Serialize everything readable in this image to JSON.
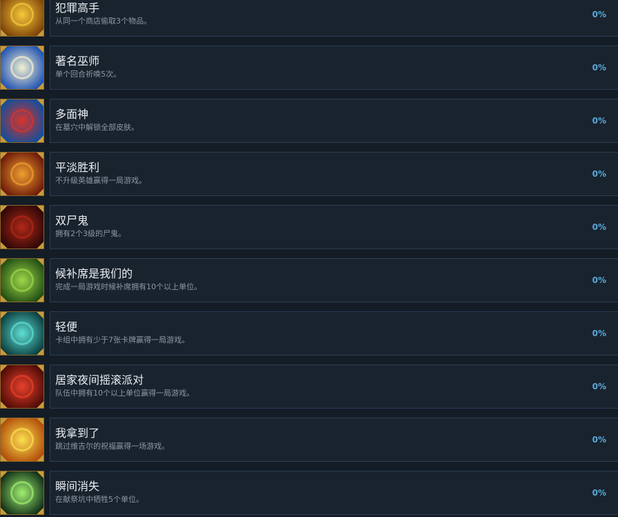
{
  "achievements": [
    {
      "title": "犯罪高手",
      "desc": "从同一个商店偷取3个物品。",
      "percent": "0%",
      "icon": "golden-swirl-icon",
      "c1": "#f6c93a",
      "c2": "#7a3e06"
    },
    {
      "title": "著名巫师",
      "desc": "单个回合祈唤5次。",
      "percent": "0%",
      "icon": "elemental-orbs-icon",
      "c1": "#f4f1d0",
      "c2": "#1c4fb3"
    },
    {
      "title": "多面神",
      "desc": "在墓穴中解锁全部皮肤。",
      "percent": "0%",
      "icon": "red-crystal-icon",
      "c1": "#d9342a",
      "c2": "#0b4fa0"
    },
    {
      "title": "平淡胜利",
      "desc": "不升级英雄赢得一局游戏。",
      "percent": "0%",
      "icon": "anvil-icon",
      "c1": "#f0a030",
      "c2": "#6a1608"
    },
    {
      "title": "双尸鬼",
      "desc": "拥有2个3级的尸鬼。",
      "percent": "0%",
      "icon": "ghoul-face-icon",
      "c1": "#b02818",
      "c2": "#2a0606"
    },
    {
      "title": "候补席是我们的",
      "desc": "完成一局游戏时候补席拥有10个以上单位。",
      "percent": "0%",
      "icon": "green-hands-icon",
      "c1": "#9ed84a",
      "c2": "#1f4a10"
    },
    {
      "title": "轻便",
      "desc": "卡组中拥有少于7张卡牌赢得一局游戏。",
      "percent": "0%",
      "icon": "rune-cards-icon",
      "c1": "#5ee0d4",
      "c2": "#0a3a3c"
    },
    {
      "title": "居家夜间摇滚派对",
      "desc": "队伍中拥有10个以上单位赢得一局游戏。",
      "percent": "0%",
      "icon": "red-claw-icon",
      "c1": "#e8402a",
      "c2": "#4a0a06"
    },
    {
      "title": "我拿到了",
      "desc": "跳过维吉尔的祝福赢得一场游戏。",
      "percent": "0%",
      "icon": "golden-sun-icon",
      "c1": "#fbe050",
      "c2": "#b04a08"
    },
    {
      "title": "瞬间消失",
      "desc": "在献祭坑中牺牲5个单位。",
      "percent": "0%",
      "icon": "green-portal-icon",
      "c1": "#a0f070",
      "c2": "#0e2a16"
    }
  ]
}
